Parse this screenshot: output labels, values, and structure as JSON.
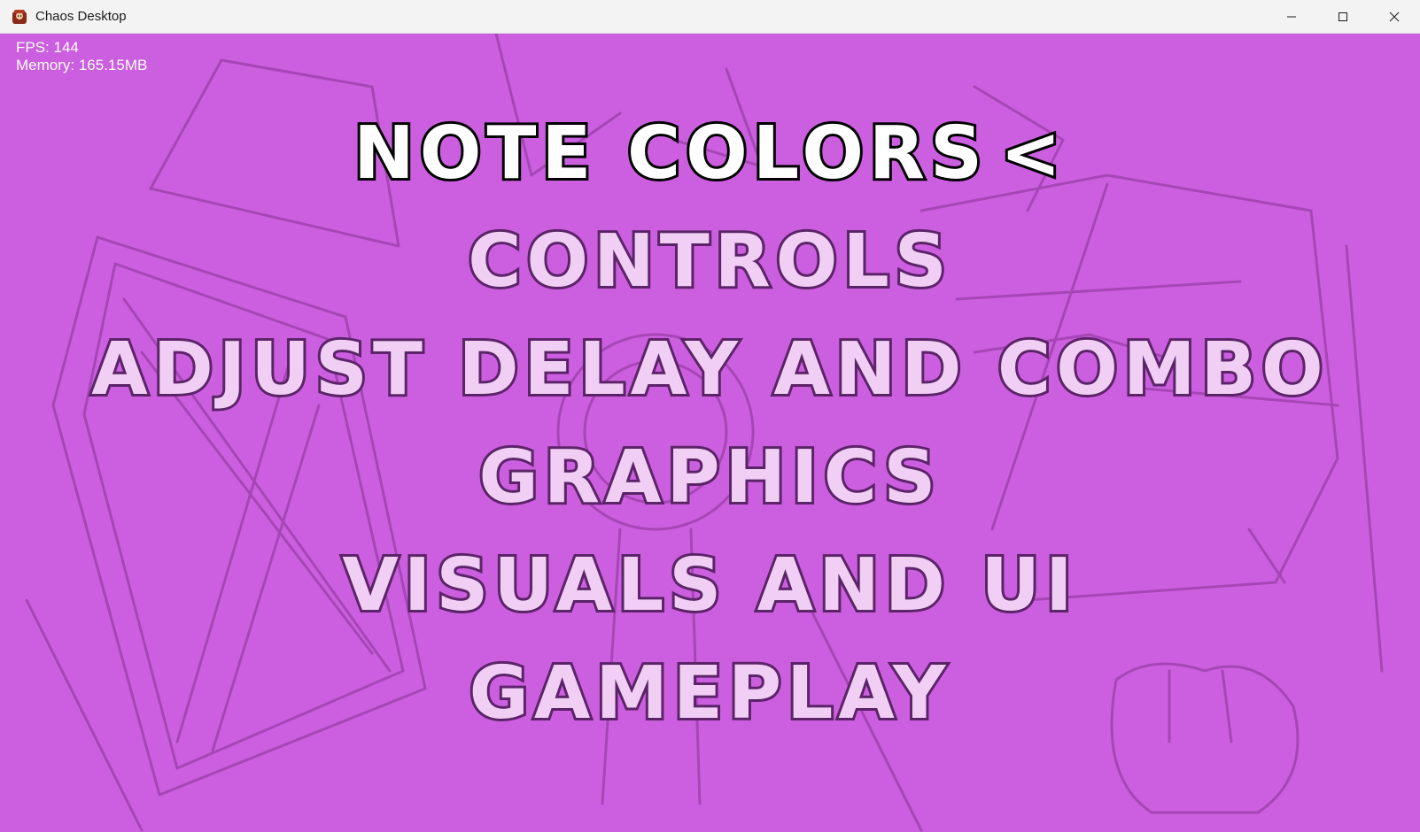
{
  "window": {
    "title": "Chaos Desktop",
    "controls": [
      "minimize",
      "maximize",
      "close"
    ]
  },
  "debug": {
    "fps": "FPS: 144",
    "memory": "Memory: 165.15MB"
  },
  "menu": {
    "selected_index": 0,
    "selector_glyph": "<",
    "items": [
      {
        "label": "NOTE COLORS",
        "selected": true
      },
      {
        "label": "CONTROLS",
        "selected": false
      },
      {
        "label": "ADJUST DELAY AND COMBO",
        "selected": false
      },
      {
        "label": "GRAPHICS",
        "selected": false
      },
      {
        "label": "VISUALS AND UI",
        "selected": false
      },
      {
        "label": "GAMEPLAY",
        "selected": false
      }
    ]
  },
  "colors": {
    "background": "#cc5fe0",
    "selected_fill": "#ffffff",
    "selected_outline": "#000000",
    "item_fill": "#f1cff5",
    "item_outline": "#5c2468"
  }
}
